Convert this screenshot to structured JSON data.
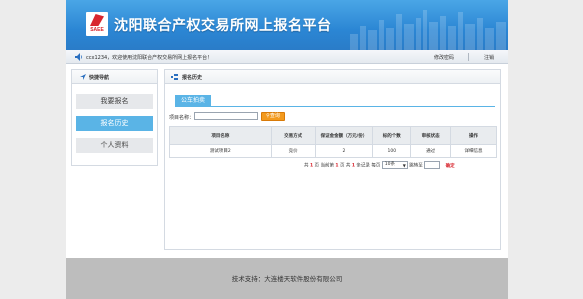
{
  "header": {
    "logo_text": "SAEE",
    "site_title": "沈阳联合产权交易所网上报名平台"
  },
  "topbar": {
    "welcome": "ccx1234，欢迎使用沈阳联合产权交易所网上报名平台！",
    "change_password": "修改密码",
    "logout": "注销"
  },
  "sidebar": {
    "title": "快捷导航",
    "items": [
      {
        "label": "我要报名"
      },
      {
        "label": "报名历史"
      },
      {
        "label": "个人资料"
      }
    ],
    "active_index": 1
  },
  "main": {
    "title": "报名历史",
    "tab": "公车拍卖",
    "search_label": "项目名称：",
    "search_value": "",
    "search_button": "查询",
    "table": {
      "columns": [
        "项目名称",
        "交易方式",
        "保证金金额（万元/份）",
        "标的个数",
        "审核状态",
        "操作"
      ],
      "rows": [
        [
          "测试项目2",
          "竞价",
          "2",
          "100",
          "通过",
          "详细信息"
        ]
      ]
    },
    "pager": {
      "prefix": "共",
      "total_pages": "1",
      "pages_word": "页 当前第",
      "current_page": "1",
      "page_word": "页 共",
      "total_records": "1",
      "records_word": "条记录 每页",
      "page_size": "10条",
      "goto_label": "跳转至",
      "confirm": "确定"
    }
  },
  "footer": {
    "text": "技术支持：大连楼天软件股份有限公司"
  },
  "colors": {
    "banner": "#2b86d4",
    "accent": "#5ab4e6",
    "button_orange": "#f39a1e",
    "red": "#d8262e"
  }
}
